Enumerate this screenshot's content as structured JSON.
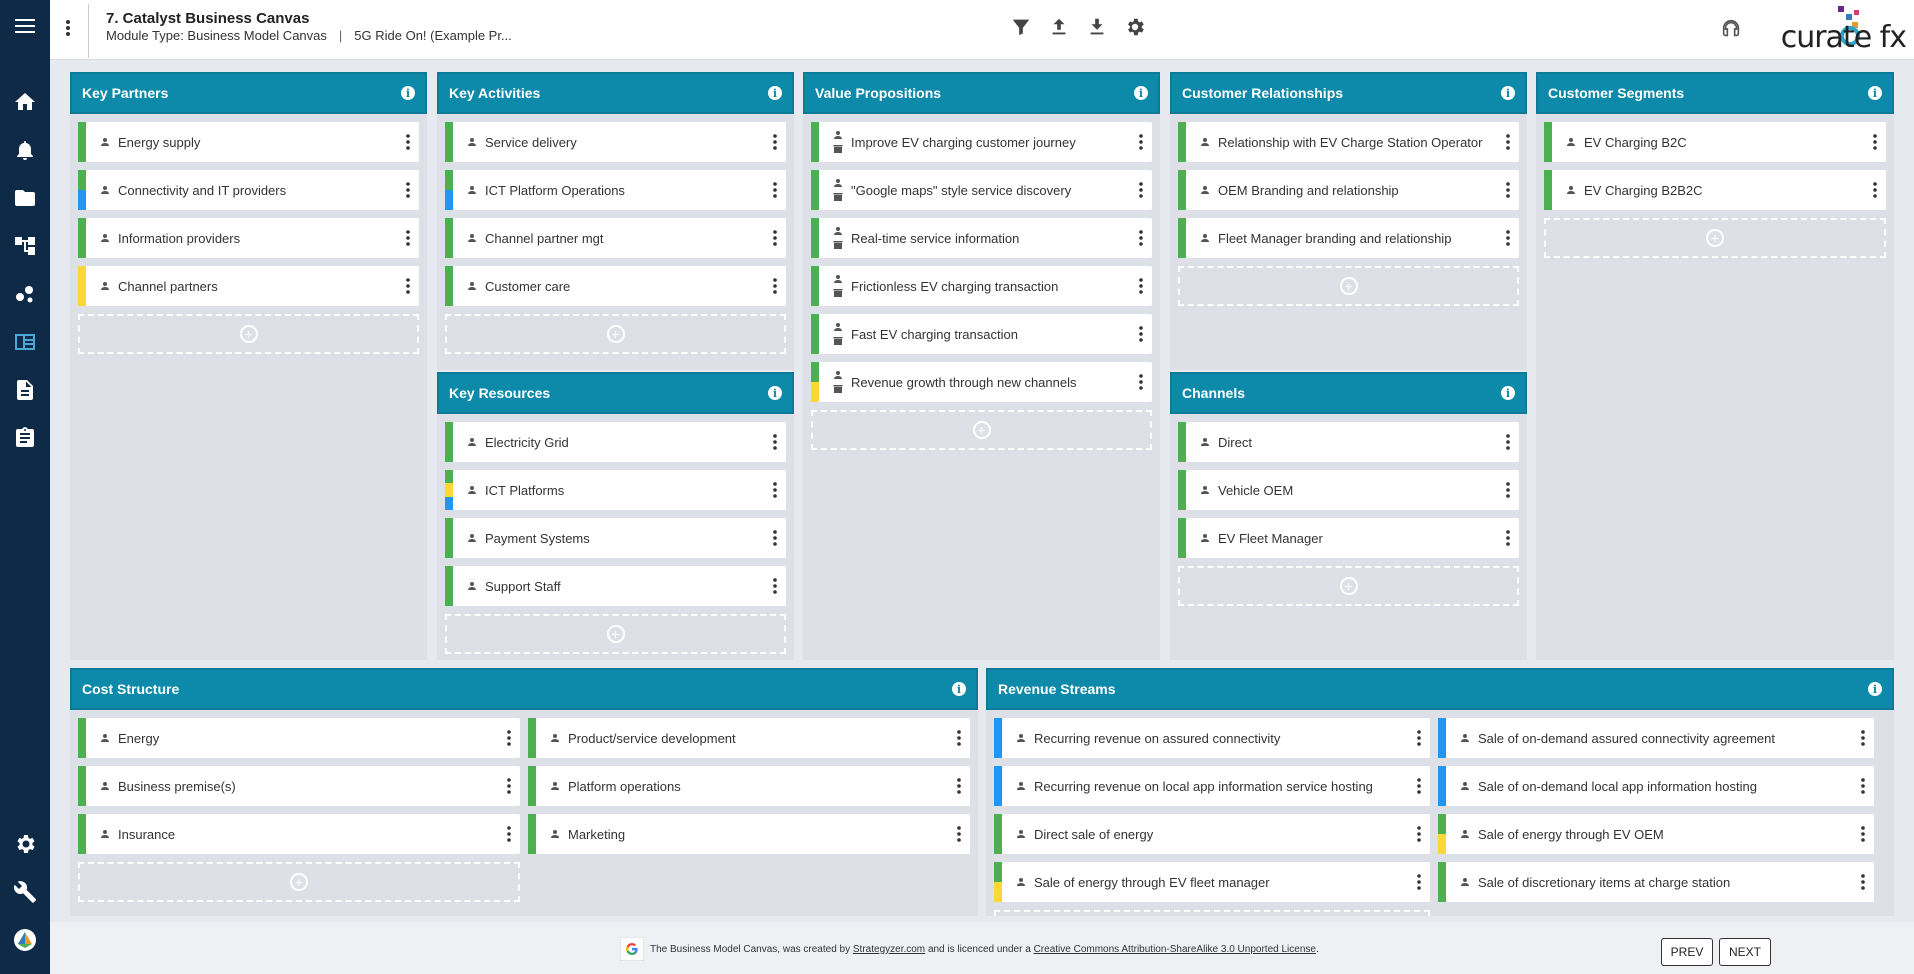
{
  "header": {
    "title": "7. Catalyst Business Canvas",
    "module_type": "Module Type: Business Model Canvas",
    "pipe": "|",
    "project": "5G Ride On! (Example Pr...",
    "logo_text": "curate fx"
  },
  "icons": {
    "rail": [
      "menu-icon",
      "home-icon",
      "bell-icon",
      "folder-icon",
      "hierarchy-icon",
      "network-icon",
      "canvas-icon",
      "document-icon",
      "clipboard-icon",
      "settings-icon",
      "wrench-icon",
      "app-logo-icon"
    ],
    "toolbar": [
      "filter-icon",
      "upload-icon",
      "download-icon",
      "gear-icon"
    ]
  },
  "colors": {
    "teal": "#0d8aaa",
    "green": "#4caf50",
    "blue": "#2196f3",
    "yellow": "#fdd835",
    "navy": "#0f2a47"
  },
  "panels": {
    "key_partners": {
      "title": "Key Partners",
      "items": [
        {
          "label": "Energy supply",
          "bar": [
            "green"
          ]
        },
        {
          "label": "Connectivity and IT providers",
          "bar": [
            "green",
            "blue"
          ]
        },
        {
          "label": "Information providers",
          "bar": [
            "green"
          ]
        },
        {
          "label": "Channel partners",
          "bar": [
            "yellow"
          ]
        }
      ]
    },
    "key_activities": {
      "title": "Key Activities",
      "items": [
        {
          "label": "Service delivery",
          "bar": [
            "green"
          ]
        },
        {
          "label": "ICT Platform Operations",
          "bar": [
            "green",
            "blue"
          ]
        },
        {
          "label": "Channel partner mgt",
          "bar": [
            "green"
          ]
        },
        {
          "label": "Customer care",
          "bar": [
            "green"
          ]
        }
      ]
    },
    "key_resources": {
      "title": "Key Resources",
      "items": [
        {
          "label": "Electricity Grid",
          "bar": [
            "green"
          ]
        },
        {
          "label": "ICT Platforms",
          "bar": [
            "green",
            "yellow",
            "blue"
          ]
        },
        {
          "label": "Payment Systems",
          "bar": [
            "green"
          ]
        },
        {
          "label": "Support Staff",
          "bar": [
            "green"
          ]
        }
      ]
    },
    "value_propositions": {
      "title": "Value Propositions",
      "items": [
        {
          "label": "Improve EV charging customer journey",
          "bar": [
            "green"
          ]
        },
        {
          "label": "\"Google maps\" style service discovery",
          "bar": [
            "green"
          ]
        },
        {
          "label": "Real-time service information",
          "bar": [
            "green"
          ]
        },
        {
          "label": "Frictionless EV charging transaction",
          "bar": [
            "green"
          ]
        },
        {
          "label": "Fast EV charging transaction",
          "bar": [
            "green"
          ]
        },
        {
          "label": "Revenue growth through new channels",
          "bar": [
            "green",
            "yellow"
          ]
        }
      ]
    },
    "customer_relationships": {
      "title": "Customer Relationships",
      "items": [
        {
          "label": "Relationship with EV Charge Station Operator",
          "bar": [
            "green"
          ]
        },
        {
          "label": "OEM Branding and relationship",
          "bar": [
            "green"
          ]
        },
        {
          "label": "Fleet Manager branding and relationship",
          "bar": [
            "green"
          ]
        }
      ]
    },
    "channels": {
      "title": "Channels",
      "items": [
        {
          "label": "Direct",
          "bar": [
            "green"
          ]
        },
        {
          "label": "Vehicle OEM",
          "bar": [
            "green"
          ]
        },
        {
          "label": "EV Fleet Manager",
          "bar": [
            "green"
          ]
        }
      ]
    },
    "customer_segments": {
      "title": "Customer Segments",
      "items": [
        {
          "label": "EV Charging B2C",
          "bar": [
            "green"
          ]
        },
        {
          "label": "EV Charging B2B2C",
          "bar": [
            "green"
          ]
        }
      ]
    },
    "cost_structure": {
      "title": "Cost Structure",
      "left": [
        {
          "label": "Energy",
          "bar": [
            "green"
          ]
        },
        {
          "label": "Business premise(s)",
          "bar": [
            "green"
          ]
        },
        {
          "label": "Insurance",
          "bar": [
            "green"
          ]
        }
      ],
      "right": [
        {
          "label": "Product/service development",
          "bar": [
            "green"
          ]
        },
        {
          "label": "Platform operations",
          "bar": [
            "green"
          ]
        },
        {
          "label": "Marketing",
          "bar": [
            "green"
          ]
        }
      ]
    },
    "revenue_streams": {
      "title": "Revenue Streams",
      "left": [
        {
          "label": "Recurring revenue on assured connectivity",
          "bar": [
            "blue"
          ]
        },
        {
          "label": "Recurring revenue on local app information service hosting",
          "bar": [
            "blue"
          ]
        },
        {
          "label": "Direct sale of energy",
          "bar": [
            "green"
          ]
        },
        {
          "label": "Sale of energy through EV fleet manager",
          "bar": [
            "green",
            "yellow"
          ]
        }
      ],
      "right": [
        {
          "label": "Sale of on-demand assured connectivity agreement",
          "bar": [
            "blue"
          ]
        },
        {
          "label": "Sale of on-demand local app information hosting",
          "bar": [
            "blue"
          ]
        },
        {
          "label": "Sale of energy through EV OEM",
          "bar": [
            "green",
            "yellow"
          ]
        },
        {
          "label": "Sale of discretionary items at charge station",
          "bar": [
            "green"
          ]
        }
      ]
    }
  },
  "footer": {
    "text_1": "The Business Model Canvas, was created by",
    "link_1": "Strategyzer.com",
    "text_2": "and is licenced under a",
    "link_2": "Creative Commons Attribution-ShareAlike 3.0 Unported License",
    "text_3": ".",
    "prev_label": "PREV",
    "next_label": "NEXT"
  }
}
